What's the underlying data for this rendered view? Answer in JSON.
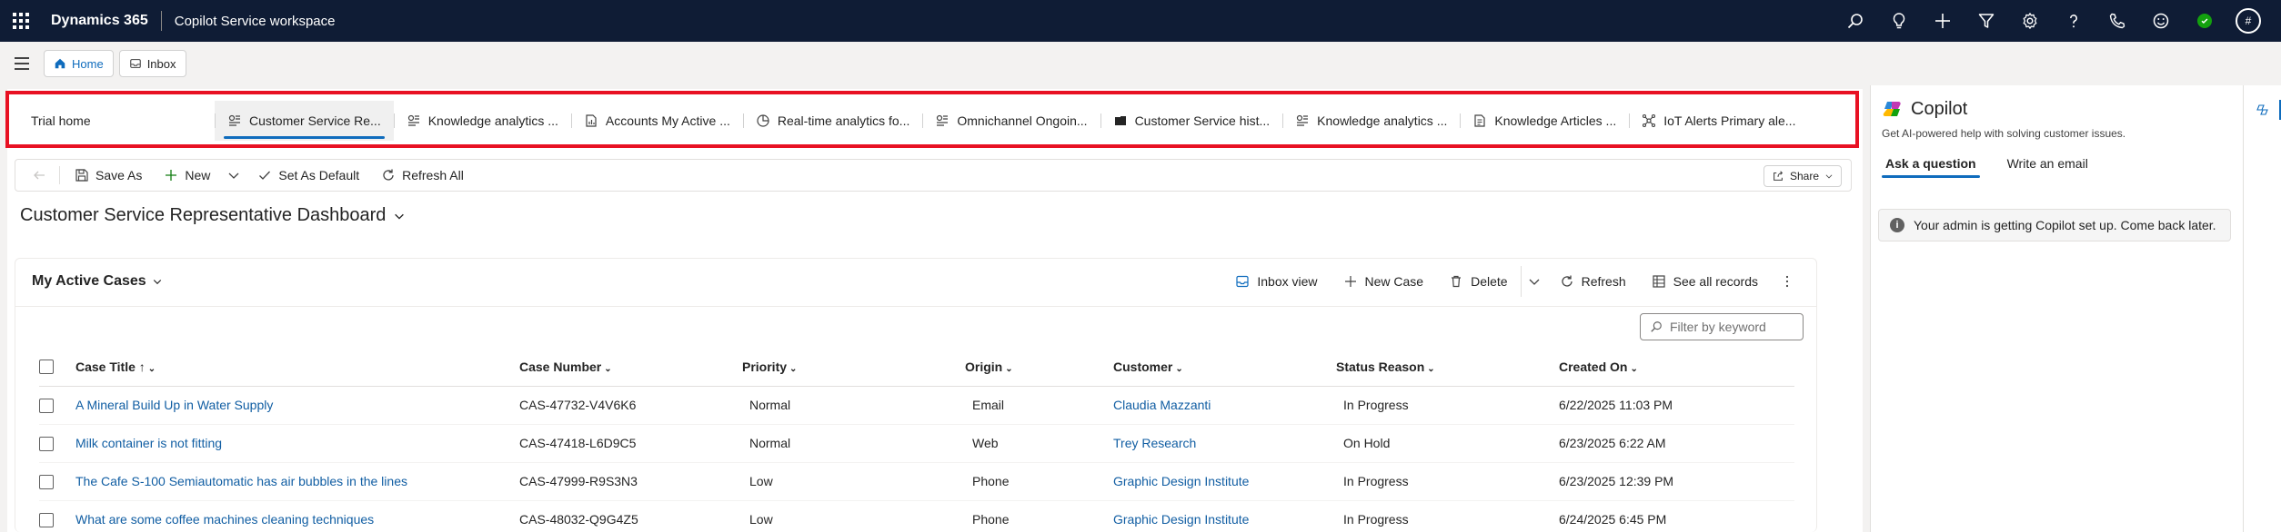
{
  "topbar": {
    "brand": "Dynamics 365",
    "app_name": "Copilot Service workspace",
    "avatar_initial": "#",
    "icons": [
      "search-icon",
      "lightbulb-icon",
      "plus-icon",
      "filter-icon",
      "gear-icon",
      "help-icon",
      "phone-icon",
      "smiley-icon",
      "presence-icon",
      "avatar"
    ]
  },
  "sessions": {
    "tabs": [
      {
        "label": "Home",
        "icon": "home-icon"
      },
      {
        "label": "Inbox",
        "icon": "inbox-icon"
      }
    ]
  },
  "dashboard_tabs": [
    {
      "label": "Trial home",
      "icon": ""
    },
    {
      "label": "Customer Service Re...",
      "icon": "dashboard-icon",
      "selected": true
    },
    {
      "label": "Knowledge analytics ...",
      "icon": "dashboard-icon"
    },
    {
      "label": "Accounts My Active ...",
      "icon": "chart-icon"
    },
    {
      "label": "Real-time analytics fo...",
      "icon": "analytics-icon"
    },
    {
      "label": "Omnichannel Ongoin...",
      "icon": "dashboard-icon"
    },
    {
      "label": "Customer Service hist...",
      "icon": "historical-icon"
    },
    {
      "label": "Knowledge analytics ...",
      "icon": "dashboard-icon"
    },
    {
      "label": "Knowledge Articles ...",
      "icon": "document-icon"
    },
    {
      "label": "IoT Alerts Primary ale...",
      "icon": "iot-icon"
    }
  ],
  "command_bar": {
    "save_as": "Save As",
    "new": "New",
    "set_as_default": "Set As Default",
    "refresh_all": "Refresh All",
    "share": "Share"
  },
  "dashboard_title": "Customer Service Representative Dashboard",
  "grid": {
    "title": "My Active Cases",
    "commands": {
      "inbox_view": "Inbox view",
      "new_case": "New Case",
      "delete": "Delete",
      "refresh": "Refresh",
      "see_all": "See all records"
    },
    "filter_placeholder": "Filter by keyword",
    "columns": [
      "Case Title",
      "Case Number",
      "Priority",
      "Origin",
      "Customer",
      "Status Reason",
      "Created On"
    ],
    "sort_indicator": "↑",
    "rows": [
      [
        "A Mineral Build Up in Water Supply",
        "CAS-47732-V4V6K6",
        "Normal",
        "Email",
        "Claudia Mazzanti",
        "In Progress",
        "6/22/2025 11:03 PM"
      ],
      [
        "Milk container is not fitting",
        "CAS-47418-L6D9C5",
        "Normal",
        "Web",
        "Trey Research",
        "On Hold",
        "6/23/2025 6:22 AM"
      ],
      [
        "The Cafe S-100 Semiautomatic has air bubbles in the lines",
        "CAS-47999-R9S3N3",
        "Low",
        "Phone",
        "Graphic Design Institute",
        "In Progress",
        "6/23/2025 12:39 PM"
      ],
      [
        "What are some coffee machines cleaning techniques",
        "CAS-48032-Q9G4Z5",
        "Low",
        "Phone",
        "Graphic Design Institute",
        "In Progress",
        "6/24/2025 6:45 PM"
      ]
    ]
  },
  "copilot": {
    "title": "Copilot",
    "subtitle": "Get AI-powered help with solving customer issues.",
    "tabs": [
      "Ask a question",
      "Write an email"
    ],
    "banner": "Your admin is getting Copilot set up. Come back later."
  },
  "colors": {
    "topbar_bg": "#0f1c35",
    "accent": "#0f6cbd",
    "link": "#115ea3",
    "highlight_border": "#e81123",
    "presence_green": "#13a10e"
  }
}
